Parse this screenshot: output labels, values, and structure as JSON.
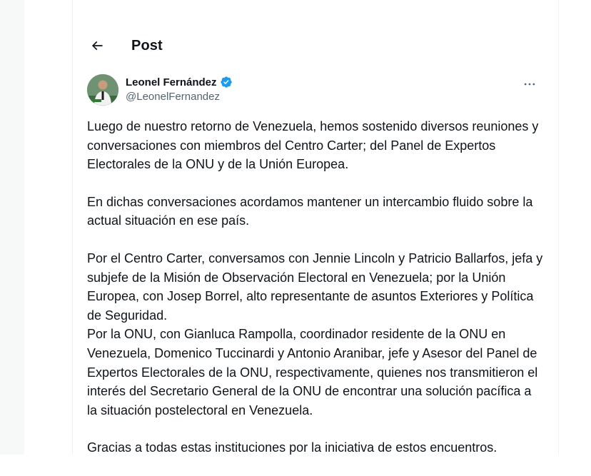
{
  "header": {
    "title": "Post",
    "back_icon": "arrow-left-icon"
  },
  "author": {
    "display_name": "Leonel Fernández",
    "handle": "@LeonelFernandez",
    "verified_icon": "verified-badge-icon",
    "verified_color": "#1d9bf0",
    "more_icon": "more-horizontal-icon"
  },
  "post": {
    "paragraphs": [
      "Luego de nuestro retorno de Venezuela, hemos sostenido diversos reuniones y conversaciones con miembros del Centro Carter; del Panel de Expertos Electorales de la ONU y de la Unión Europea.",
      "En dichas conversaciones acordamos mantener un intercambio fluido sobre la actual situación en ese país.",
      "Por el Centro Carter, conversamos con Jennie Lincoln y Patricio Ballarfos, jefa y subjefe de la Misión de Observación Electoral en Venezuela; por la Unión Europea, con Josep Borrel, alto representante de asuntos Exteriores y Política de Seguridad.\nPor la ONU, con Gianluca Rampolla, coordinador residente de la ONU en Venezuela, Domenico Tuccinardi y Antonio Aranibar, jefe y Asesor del Panel de Expertos Electorales de la ONU, respectivamente, quienes nos transmitieron el interés del Secretario General de la ONU de encontrar una solución pacífica a la situación postelectoral en Venezuela.",
      "Gracias a todas estas instituciones por la iniciativa de estos encuentros."
    ]
  }
}
